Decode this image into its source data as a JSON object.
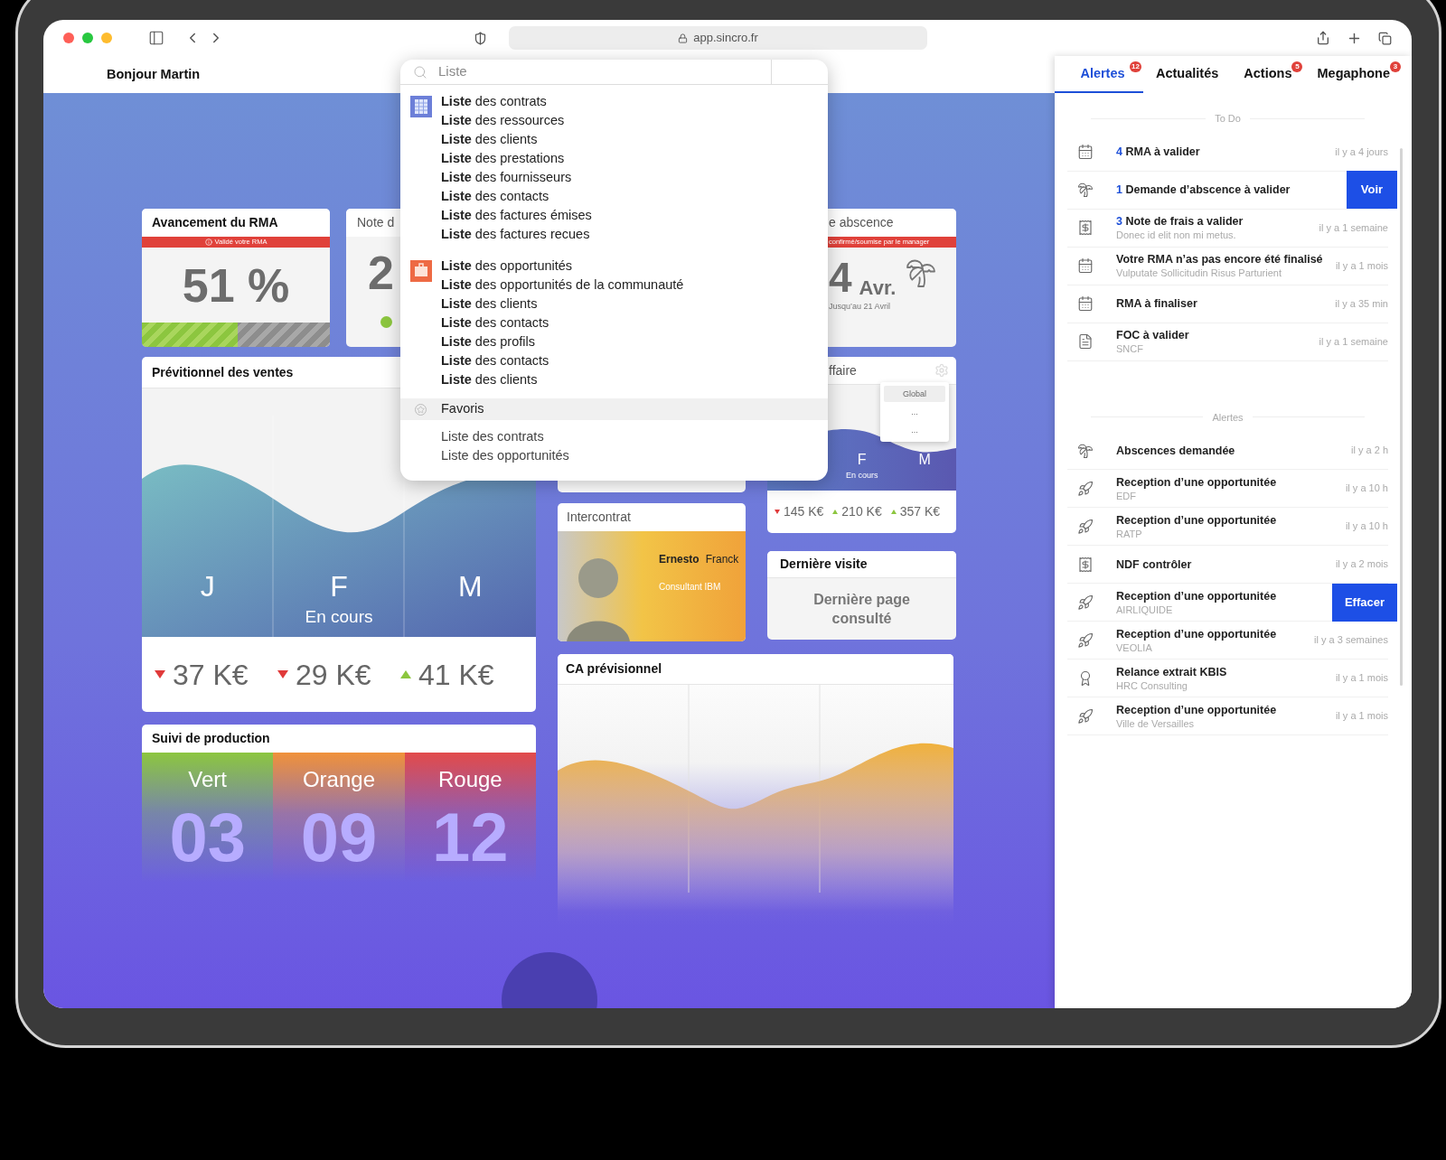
{
  "browser": {
    "url": "app.sincro.fr"
  },
  "header": {
    "greeting": "Bonjour Martin"
  },
  "search": {
    "value": "Liste",
    "groups": [
      {
        "kind": "grid",
        "items": [
          "**Liste** des contrats",
          "**Liste** des ressources",
          "**Liste** des clients",
          "**Liste** des prestations",
          "**Liste** des fournisseurs",
          "**Liste** des contacts",
          "**Liste** des factures émises",
          "**Liste** des factures recues"
        ]
      },
      {
        "kind": "briefcase",
        "items": [
          "**Liste** des opportunités",
          "**Liste** des opportunités de la communauté",
          "**Liste** des clients",
          "**Liste** des contacts",
          "**Liste** des profils",
          "**Liste** des contacts",
          "**Liste** des clients"
        ]
      }
    ],
    "favorites": {
      "label": "Favoris",
      "items": [
        "Liste des contrats",
        "Liste des opportunités"
      ]
    }
  },
  "rma_card": {
    "title": "Avancement du RMA",
    "banner": "Validé votre RMA",
    "value": "51 %",
    "level": 0.51
  },
  "note_card": {
    "title": "Note d",
    "value": "2"
  },
  "sales_card": {
    "title": "Prévitionnel des ventes",
    "months": [
      {
        "label": "J"
      },
      {
        "label": "F",
        "note": "En cours"
      },
      {
        "label": "M"
      }
    ],
    "values": [
      {
        "kind": "down",
        "value": "37 K€"
      },
      {
        "kind": "down",
        "value": "29 K€"
      },
      {
        "kind": "up",
        "value": "41 K€"
      }
    ]
  },
  "production_card": {
    "title": "Suivi de production",
    "columns": [
      {
        "label": "Vert",
        "value": "03",
        "color": "#8cc63f"
      },
      {
        "label": "Orange",
        "value": "09",
        "color": "#f0913a"
      },
      {
        "label": "Rouge",
        "value": "12",
        "color": "#e24a4a"
      }
    ]
  },
  "absence_card": {
    "title": "e abscence",
    "banner": "confirmé/soumise par le manager",
    "day": "4",
    "month": "Avr.",
    "until": "Jusqu’au 21 Avril"
  },
  "affaire_card": {
    "title": "ffaire",
    "months": [
      {
        "label": "F",
        "note": "En cours"
      },
      {
        "label": "M"
      }
    ],
    "values": [
      {
        "kind": "down",
        "value": "145 K€"
      },
      {
        "kind": "up",
        "value": "210 K€"
      },
      {
        "kind": "up",
        "value": "357 K€"
      }
    ],
    "menu": [
      {
        "label": "Global",
        "selected": true
      },
      {
        "label": "...",
        "selected": false
      },
      {
        "label": "...",
        "selected": false
      }
    ]
  },
  "intercontrat_card": {
    "title": "Intercontrat",
    "first_name": "Ernesto",
    "last_name": "Franck",
    "role": "Consultant IBM"
  },
  "last_visit_card": {
    "title": "Dernière visite",
    "text": "Dernière page consulté"
  },
  "forecast_card": {
    "title": "CA prévisionnel"
  },
  "panel": {
    "tabs": [
      {
        "label": "Alertes",
        "badge": "12",
        "selected": true
      },
      {
        "label": "Actualités",
        "selected": false
      },
      {
        "label": "Actions",
        "badge": "5",
        "selected": false
      },
      {
        "label": "Megaphone",
        "badge": "3",
        "selected": false
      }
    ],
    "sections": [
      {
        "title": "To Do",
        "items": [
          {
            "kind": "calendar",
            "count": "4",
            "title": "RMA à valider",
            "time": "il y a 4 jours"
          },
          {
            "kind": "palm",
            "count": "1",
            "title": "Demande d’abscence à valider",
            "action": "Voir"
          },
          {
            "kind": "receipt",
            "count": "3",
            "title": "Note de frais a valider",
            "subtitle": "Donec id elit non mi metus.",
            "time": "il y a 1 semaine"
          },
          {
            "kind": "calendar",
            "title": "Votre RMA n’as pas encore été finalisé",
            "subtitle": "Vulputate Sollicitudin Risus Parturient",
            "time": "il y a 1 mois"
          },
          {
            "kind": "calendar",
            "title": "RMA à finaliser",
            "time": "il y a 35 min"
          },
          {
            "kind": "document",
            "title": "FOC à valider",
            "subtitle": "SNCF",
            "time": "il y a 1 semaine"
          }
        ]
      },
      {
        "title": "Alertes",
        "items": [
          {
            "kind": "palm",
            "title": "Abscences demandée",
            "time": "il y a 2 h"
          },
          {
            "kind": "rocket",
            "title": "Reception d’une opportunitée",
            "subtitle": "EDF",
            "time": "il y a 10 h"
          },
          {
            "kind": "rocket",
            "title": "Reception d’une opportunitée",
            "subtitle": "RATP",
            "time": "il y a 10 h"
          },
          {
            "kind": "receipt",
            "title": "NDF contrôler",
            "time": "il y a 2 mois"
          },
          {
            "kind": "rocket",
            "title": "Reception d’une opportunitée",
            "subtitle": "AIRLIQUIDE",
            "action": "Effacer"
          },
          {
            "kind": "rocket",
            "title": "Reception d’une opportunitée",
            "subtitle": "VEOLIA",
            "time": "il y a 3 semaines"
          },
          {
            "kind": "seal",
            "title": "Relance extrait KBIS",
            "subtitle": "HRC Consulting",
            "time": "il y a 1 mois"
          },
          {
            "kind": "rocket",
            "title": "Reception d’une opportunitée",
            "subtitle": "Ville de Versailles",
            "time": "il y a 1 mois"
          }
        ]
      }
    ]
  }
}
